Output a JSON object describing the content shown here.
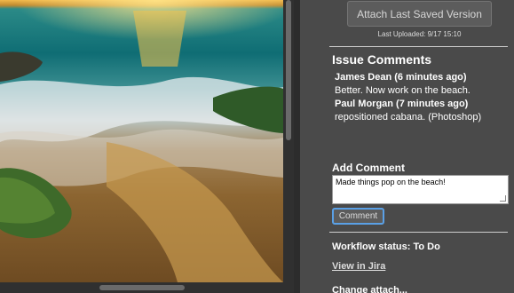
{
  "panel": {
    "attach_button_label": "Attach Last Saved Version",
    "last_uploaded": "Last Uploaded: 9/17 15:10",
    "issue_comments_title": "Issue Comments",
    "comments": [
      {
        "author": "James Dean (6 minutes ago)",
        "text": "Better. Now work on the beach."
      },
      {
        "author": "Paul Morgan (7 minutes ago)",
        "text": "repositioned cabana. (Photoshop)"
      }
    ],
    "add_comment_title": "Add Comment",
    "comment_input_value": "Made things pop on the beach!",
    "comment_button_label": "Comment",
    "workflow_status": "Workflow status: To Do",
    "view_in_jira": "View in Jira",
    "cutoff_text": "Change attach..."
  },
  "colors": {
    "panel_bg": "#4a4a4a",
    "focus_ring": "#5aa0e6"
  }
}
